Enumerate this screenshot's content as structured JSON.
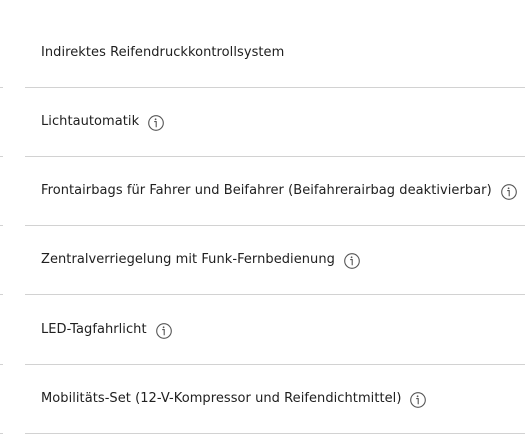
{
  "features": [
    {
      "label": "Indirektes Reifendruckkontrollsystem",
      "has_info": false,
      "icon": "info-icon"
    },
    {
      "label": "Lichtautomatik",
      "has_info": true,
      "icon": "info-icon"
    },
    {
      "label": "Frontairbags für Fahrer und Beifahrer (Beifahrerairbag deaktivierbar)",
      "has_info": true,
      "icon": "info-icon"
    },
    {
      "label": "Zentralverriegelung mit Funk-Fernbedienung",
      "has_info": true,
      "icon": "info-icon"
    },
    {
      "label": "LED-Tagfahrlicht",
      "has_info": true,
      "icon": "info-icon"
    },
    {
      "label": "Mobilitäts-Set (12-V-Kompressor und Reifendichtmittel)",
      "has_info": true,
      "icon": "info-icon"
    }
  ],
  "colors": {
    "text": "#202020",
    "divider": "#d2d2d2",
    "icon": "#555555"
  }
}
